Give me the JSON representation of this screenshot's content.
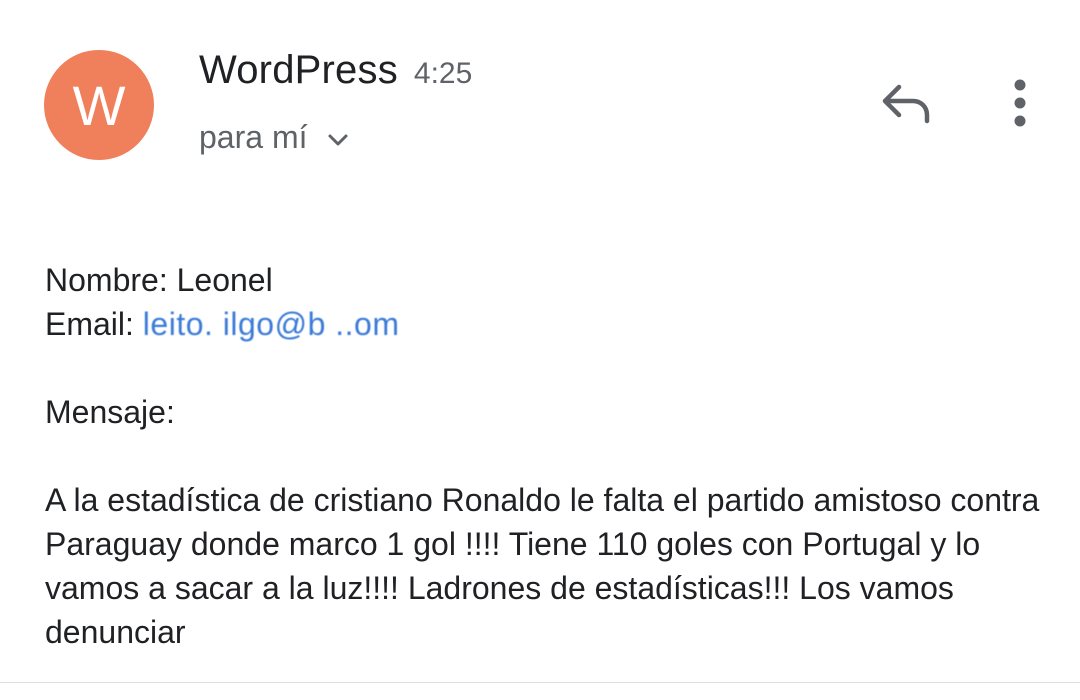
{
  "header": {
    "avatar_letter": "W",
    "avatar_color": "#f07f5c",
    "sender": "WordPress",
    "time": "4:25",
    "recipient": "para mí"
  },
  "icons": {
    "expand": "chevron-down-icon",
    "reply": "reply-icon",
    "more": "more-vertical-icon"
  },
  "body": {
    "name_label": "Nombre:",
    "name_value": "Leonel",
    "email_label": "Email:",
    "email_value": "leito.  ilgo@b       ..om",
    "message_label": "Mensaje:",
    "message": "A la estadística de cristiano Ronaldo le falta el partido amistoso contra Paraguay donde marco 1 gol !!!! Tiene 110 goles con Portugal y lo vamos a sacar a la luz!!!! Ladrones de estadísticas!!! Los vamos denunciar"
  },
  "colors": {
    "link": "#3b7bd8",
    "secondary_text": "#5f6368",
    "primary_text": "#202124"
  }
}
